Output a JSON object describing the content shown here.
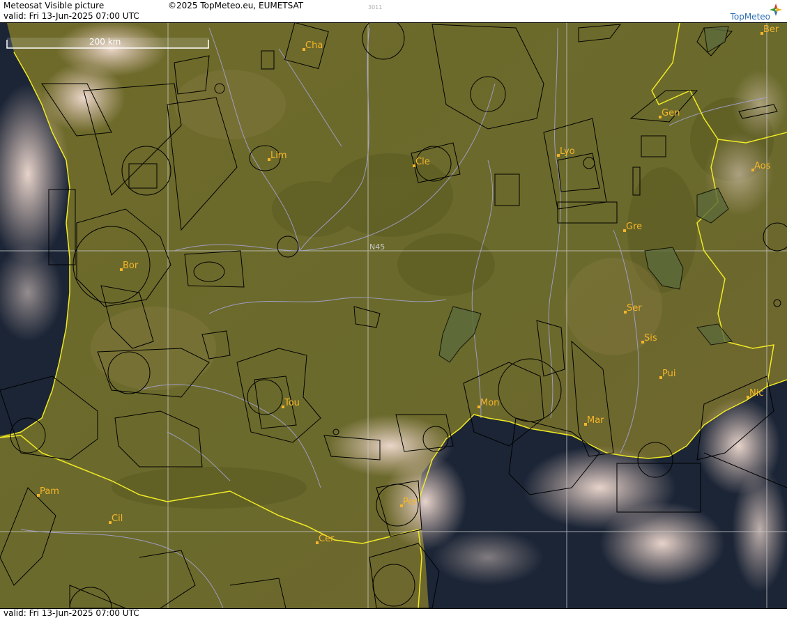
{
  "header": {
    "title": "Meteosat Visible picture",
    "valid": "valid:  Fri  13-Jun-2025  07:00 UTC",
    "copyright": "©2025 TopMeteo.eu, EUMETSAT",
    "code": "3011",
    "brand": "TopMeteo"
  },
  "footer": {
    "valid": "valid:  Fri  13-Jun-2025  07:00 UTC"
  },
  "scale_bar": {
    "label": "200 km"
  },
  "latitude_label": "N45",
  "cities": [
    {
      "id": "cha",
      "label": "Cha"
    },
    {
      "id": "ber",
      "label": "Ber"
    },
    {
      "id": "gen",
      "label": "Gen"
    },
    {
      "id": "lim",
      "label": "Lim"
    },
    {
      "id": "cle",
      "label": "Cle"
    },
    {
      "id": "lyo",
      "label": "Lyo"
    },
    {
      "id": "aos",
      "label": "Aos"
    },
    {
      "id": "gre",
      "label": "Gre"
    },
    {
      "id": "bor",
      "label": "Bor"
    },
    {
      "id": "ser",
      "label": "Ser"
    },
    {
      "id": "sis",
      "label": "Sis"
    },
    {
      "id": "pui",
      "label": "Pui"
    },
    {
      "id": "tou",
      "label": "Tou"
    },
    {
      "id": "mon",
      "label": "Mon"
    },
    {
      "id": "nic",
      "label": "Nic"
    },
    {
      "id": "mar",
      "label": "Mar"
    },
    {
      "id": "pam",
      "label": "Pam"
    },
    {
      "id": "per",
      "label": "Per"
    },
    {
      "id": "cil",
      "label": "Cil"
    },
    {
      "id": "cer",
      "label": "Cer"
    }
  ],
  "colors": {
    "land": "#6e6a2c",
    "sea": "#1b2536",
    "cloud": "#e4c8bc",
    "border": "#f0ea24",
    "label": "#f5b52a",
    "airspace": "#000000",
    "river": "#a7a6dc",
    "grid": "#c8c8c8"
  }
}
